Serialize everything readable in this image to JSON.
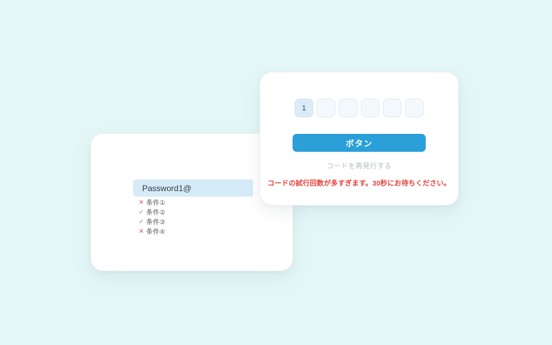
{
  "password_card": {
    "input_value": "Password1@",
    "conditions": [
      {
        "label": "条件①",
        "status": "fail",
        "icon": "✕"
      },
      {
        "label": "条件②",
        "status": "pass",
        "icon": "✓"
      },
      {
        "label": "条件③",
        "status": "pass",
        "icon": "✓"
      },
      {
        "label": "条件④",
        "status": "fail",
        "icon": "✕"
      }
    ]
  },
  "code_card": {
    "code_boxes": [
      "1",
      "",
      "",
      "",
      "",
      ""
    ],
    "button_label": "ボタン",
    "resend_label": "コードを再発行する",
    "error_message": "コードの試行回数が多すぎます。30秒にお待ちください。"
  },
  "colors": {
    "page_background": "#e4f7f7",
    "card_background": "#ffffff",
    "accent_blue": "#2b9fd8",
    "input_background": "#d5ecf8",
    "filled_box_background": "#d9ecf8",
    "empty_box_background": "#f4f9fd",
    "error_red": "#e8413c",
    "muted_gray": "#b3bcc2",
    "pass_green": "#3fae5f",
    "fail_red": "#dd524c"
  }
}
